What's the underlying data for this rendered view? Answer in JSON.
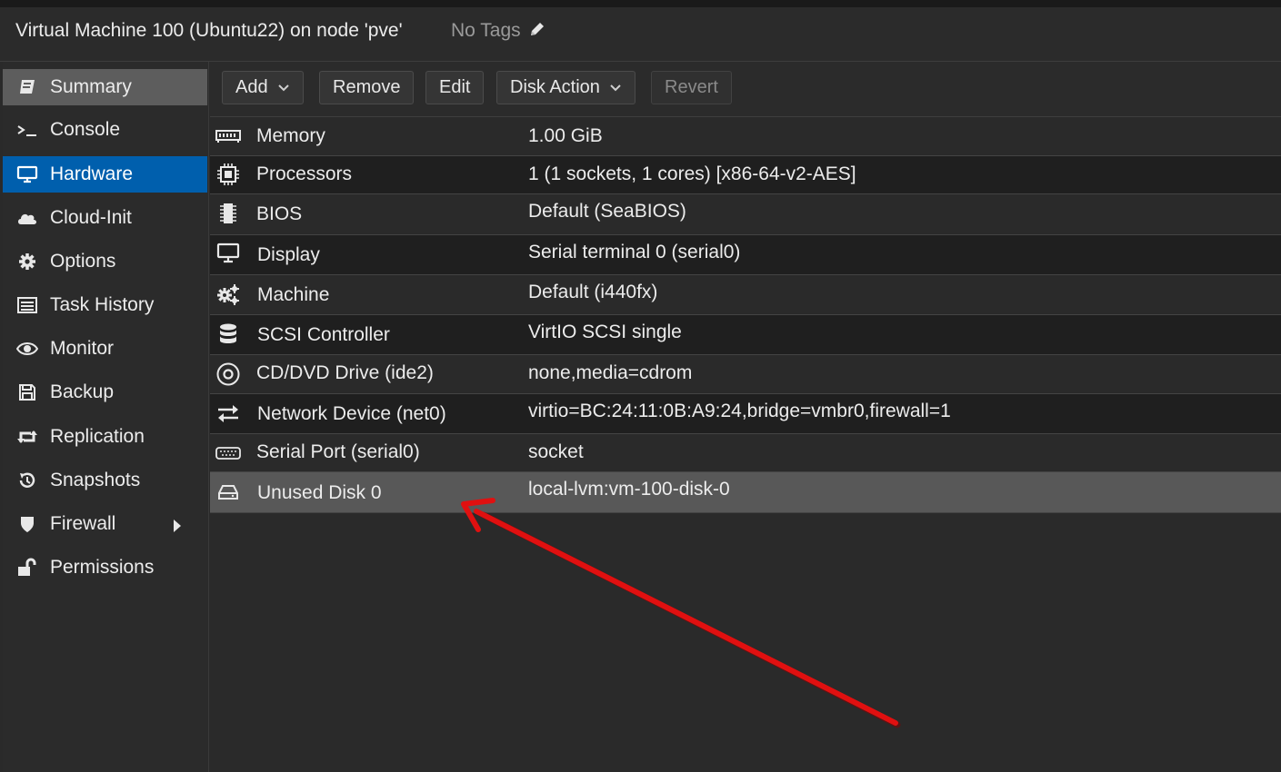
{
  "header": {
    "title": "Virtual Machine 100 (Ubuntu22) on node 'pve'",
    "tags_label": "No Tags"
  },
  "sidebar": {
    "items": [
      {
        "label": "Summary",
        "icon": "book-icon"
      },
      {
        "label": "Console",
        "icon": "terminal-icon"
      },
      {
        "label": "Hardware",
        "icon": "desktop-icon"
      },
      {
        "label": "Cloud-Init",
        "icon": "cloud-icon"
      },
      {
        "label": "Options",
        "icon": "gear-icon"
      },
      {
        "label": "Task History",
        "icon": "list-icon"
      },
      {
        "label": "Monitor",
        "icon": "eye-icon"
      },
      {
        "label": "Backup",
        "icon": "floppy-icon"
      },
      {
        "label": "Replication",
        "icon": "retweet-icon"
      },
      {
        "label": "Snapshots",
        "icon": "history-icon"
      },
      {
        "label": "Firewall",
        "icon": "shield-icon"
      },
      {
        "label": "Permissions",
        "icon": "unlock-icon"
      }
    ],
    "active": "Hardware"
  },
  "toolbar": {
    "add": "Add",
    "remove": "Remove",
    "edit": "Edit",
    "disk_action": "Disk Action",
    "revert": "Revert"
  },
  "hardware": [
    {
      "name": "Memory",
      "value": "1.00 GiB",
      "icon": "memory-icon"
    },
    {
      "name": "Processors",
      "value": "1 (1 sockets, 1 cores) [x86-64-v2-AES]",
      "icon": "cpu-icon"
    },
    {
      "name": "BIOS",
      "value": "Default (SeaBIOS)",
      "icon": "chip-icon"
    },
    {
      "name": "Display",
      "value": "Serial terminal 0 (serial0)",
      "icon": "desktop-icon"
    },
    {
      "name": "Machine",
      "value": "Default (i440fx)",
      "icon": "cogs-icon"
    },
    {
      "name": "SCSI Controller",
      "value": "VirtIO SCSI single",
      "icon": "database-icon"
    },
    {
      "name": "CD/DVD Drive (ide2)",
      "value": "none,media=cdrom",
      "icon": "disc-icon"
    },
    {
      "name": "Network Device (net0)",
      "value": "virtio=BC:24:11:0B:A9:24,bridge=vmbr0,firewall=1",
      "icon": "exchange-icon"
    },
    {
      "name": "Serial Port (serial0)",
      "value": "socket",
      "icon": "keyboard-icon"
    },
    {
      "name": "Unused Disk 0",
      "value": "local-lvm:vm-100-disk-0",
      "icon": "hdd-icon"
    }
  ],
  "selected_row": "Unused Disk 0",
  "colors": {
    "active_nav": "#005fad",
    "selected_row": "#585858",
    "annotation_arrow": "#e01010"
  }
}
